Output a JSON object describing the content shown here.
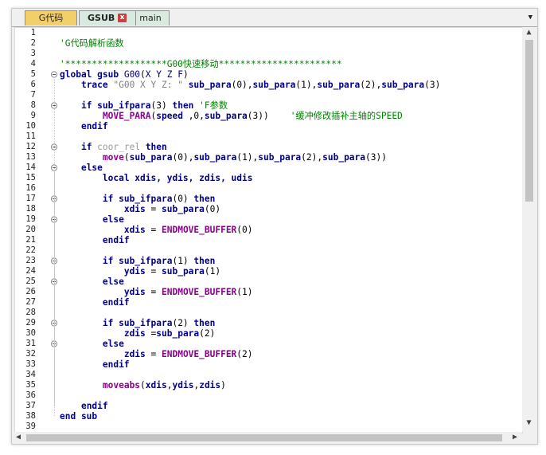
{
  "tabs": [
    {
      "label": "G代码"
    },
    {
      "label": "GSUB",
      "close_label": "x"
    },
    {
      "label": "main"
    }
  ],
  "tab_menu_label": "▼",
  "editor": {
    "lines": [
      {
        "n": "1",
        "code": []
      },
      {
        "n": "2",
        "code": [
          {
            "c": "cm",
            "t": "'G代码解析函数"
          }
        ]
      },
      {
        "n": "3",
        "code": []
      },
      {
        "n": "4",
        "code": [
          {
            "c": "cm",
            "t": "'*******************G00快速移动***********************"
          }
        ]
      },
      {
        "n": "5",
        "fold": "open",
        "code": [
          {
            "c": "kw",
            "t": "global gsub "
          },
          {
            "c": "fn",
            "t": "G00"
          },
          {
            "c": "",
            "t": "("
          },
          {
            "c": "fn",
            "t": "X Y Z F"
          },
          {
            "c": "",
            "t": ")"
          }
        ]
      },
      {
        "n": "6",
        "code": [
          {
            "c": "",
            "t": "    "
          },
          {
            "c": "kw",
            "t": "trace "
          },
          {
            "c": "st",
            "t": "\"G00 X Y Z: \""
          },
          {
            "c": "",
            "t": " "
          },
          {
            "c": "kw",
            "t": "sub_para"
          },
          {
            "c": "",
            "t": "(0),"
          },
          {
            "c": "kw",
            "t": "sub_para"
          },
          {
            "c": "",
            "t": "(1),"
          },
          {
            "c": "kw",
            "t": "sub_para"
          },
          {
            "c": "",
            "t": "(2),"
          },
          {
            "c": "kw",
            "t": "sub_para"
          },
          {
            "c": "",
            "t": "(3)"
          }
        ]
      },
      {
        "n": "7",
        "code": []
      },
      {
        "n": "8",
        "fold": "open",
        "code": [
          {
            "c": "",
            "t": "    "
          },
          {
            "c": "kw",
            "t": "if sub_ifpara"
          },
          {
            "c": "",
            "t": "(3) "
          },
          {
            "c": "kw",
            "t": "then "
          },
          {
            "c": "cm",
            "t": "'F参数"
          }
        ]
      },
      {
        "n": "9",
        "code": [
          {
            "c": "",
            "t": "        "
          },
          {
            "c": "pr",
            "t": "MOVE_PARA"
          },
          {
            "c": "",
            "t": "("
          },
          {
            "c": "kw",
            "t": "speed"
          },
          {
            "c": "",
            "t": " ,0,"
          },
          {
            "c": "kw",
            "t": "sub_para"
          },
          {
            "c": "",
            "t": "(3))    "
          },
          {
            "c": "cm",
            "t": "'缓冲修改插补主轴的SPEED"
          }
        ]
      },
      {
        "n": "10",
        "code": [
          {
            "c": "",
            "t": "    "
          },
          {
            "c": "kw",
            "t": "endif"
          }
        ]
      },
      {
        "n": "11",
        "code": []
      },
      {
        "n": "12",
        "fold": "open",
        "code": [
          {
            "c": "",
            "t": "    "
          },
          {
            "c": "kw",
            "t": "if "
          },
          {
            "c": "gy",
            "t": "coor_rel"
          },
          {
            "c": "",
            "t": " "
          },
          {
            "c": "kw",
            "t": "then"
          }
        ]
      },
      {
        "n": "13",
        "code": [
          {
            "c": "",
            "t": "        "
          },
          {
            "c": "pr",
            "t": "move"
          },
          {
            "c": "",
            "t": "("
          },
          {
            "c": "kw",
            "t": "sub_para"
          },
          {
            "c": "",
            "t": "(0),"
          },
          {
            "c": "kw",
            "t": "sub_para"
          },
          {
            "c": "",
            "t": "(1),"
          },
          {
            "c": "kw",
            "t": "sub_para"
          },
          {
            "c": "",
            "t": "(2),"
          },
          {
            "c": "kw",
            "t": "sub_para"
          },
          {
            "c": "",
            "t": "(3))"
          }
        ]
      },
      {
        "n": "14",
        "fold": "open",
        "code": [
          {
            "c": "",
            "t": "    "
          },
          {
            "c": "kw",
            "t": "else"
          }
        ]
      },
      {
        "n": "15",
        "code": [
          {
            "c": "",
            "t": "        "
          },
          {
            "c": "kw",
            "t": "local xdis, ydis, zdis, udis"
          }
        ]
      },
      {
        "n": "16",
        "code": []
      },
      {
        "n": "17",
        "fold": "open",
        "code": [
          {
            "c": "",
            "t": "        "
          },
          {
            "c": "kw",
            "t": "if sub_ifpara"
          },
          {
            "c": "",
            "t": "(0) "
          },
          {
            "c": "kw",
            "t": "then"
          }
        ]
      },
      {
        "n": "18",
        "code": [
          {
            "c": "",
            "t": "            "
          },
          {
            "c": "kw",
            "t": "xdis"
          },
          {
            "c": "",
            "t": " = "
          },
          {
            "c": "kw",
            "t": "sub_para"
          },
          {
            "c": "",
            "t": "(0)"
          }
        ]
      },
      {
        "n": "19",
        "fold": "open",
        "code": [
          {
            "c": "",
            "t": "        "
          },
          {
            "c": "kw",
            "t": "else"
          }
        ]
      },
      {
        "n": "20",
        "code": [
          {
            "c": "",
            "t": "            "
          },
          {
            "c": "kw",
            "t": "xdis"
          },
          {
            "c": "",
            "t": " = "
          },
          {
            "c": "pr",
            "t": "ENDMOVE_BUFFER"
          },
          {
            "c": "",
            "t": "(0)"
          }
        ]
      },
      {
        "n": "21",
        "code": [
          {
            "c": "",
            "t": "        "
          },
          {
            "c": "kw",
            "t": "endif"
          }
        ]
      },
      {
        "n": "22",
        "code": []
      },
      {
        "n": "23",
        "fold": "open",
        "code": [
          {
            "c": "",
            "t": "        "
          },
          {
            "c": "kw",
            "t": "if sub_ifpara"
          },
          {
            "c": "",
            "t": "(1) "
          },
          {
            "c": "kw",
            "t": "then"
          }
        ]
      },
      {
        "n": "24",
        "code": [
          {
            "c": "",
            "t": "            "
          },
          {
            "c": "kw",
            "t": "ydis"
          },
          {
            "c": "",
            "t": " = "
          },
          {
            "c": "kw",
            "t": "sub_para"
          },
          {
            "c": "",
            "t": "(1)"
          }
        ]
      },
      {
        "n": "25",
        "fold": "open",
        "code": [
          {
            "c": "",
            "t": "        "
          },
          {
            "c": "kw",
            "t": "else"
          }
        ]
      },
      {
        "n": "26",
        "code": [
          {
            "c": "",
            "t": "            "
          },
          {
            "c": "kw",
            "t": "ydis"
          },
          {
            "c": "",
            "t": " = "
          },
          {
            "c": "pr",
            "t": "ENDMOVE_BUFFER"
          },
          {
            "c": "",
            "t": "(1)"
          }
        ]
      },
      {
        "n": "27",
        "code": [
          {
            "c": "",
            "t": "        "
          },
          {
            "c": "kw",
            "t": "endif"
          }
        ]
      },
      {
        "n": "28",
        "code": []
      },
      {
        "n": "29",
        "fold": "open",
        "code": [
          {
            "c": "",
            "t": "        "
          },
          {
            "c": "kw",
            "t": "if sub_ifpara"
          },
          {
            "c": "",
            "t": "(2) "
          },
          {
            "c": "kw",
            "t": "then"
          }
        ]
      },
      {
        "n": "30",
        "code": [
          {
            "c": "",
            "t": "            "
          },
          {
            "c": "kw",
            "t": "zdis"
          },
          {
            "c": "",
            "t": " ="
          },
          {
            "c": "kw",
            "t": "sub_para"
          },
          {
            "c": "",
            "t": "(2)"
          }
        ]
      },
      {
        "n": "31",
        "fold": "open",
        "code": [
          {
            "c": "",
            "t": "        "
          },
          {
            "c": "kw",
            "t": "else"
          }
        ]
      },
      {
        "n": "32",
        "code": [
          {
            "c": "",
            "t": "            "
          },
          {
            "c": "kw",
            "t": "zdis"
          },
          {
            "c": "",
            "t": " = "
          },
          {
            "c": "pr",
            "t": "ENDMOVE_BUFFER"
          },
          {
            "c": "",
            "t": "(2)"
          }
        ]
      },
      {
        "n": "33",
        "code": [
          {
            "c": "",
            "t": "        "
          },
          {
            "c": "kw",
            "t": "endif"
          }
        ]
      },
      {
        "n": "34",
        "code": []
      },
      {
        "n": "35",
        "code": [
          {
            "c": "",
            "t": "        "
          },
          {
            "c": "pr",
            "t": "moveabs"
          },
          {
            "c": "",
            "t": "("
          },
          {
            "c": "kw",
            "t": "xdis"
          },
          {
            "c": "",
            "t": ","
          },
          {
            "c": "kw",
            "t": "ydis"
          },
          {
            "c": "",
            "t": ","
          },
          {
            "c": "kw",
            "t": "zdis"
          },
          {
            "c": "",
            "t": ")"
          }
        ]
      },
      {
        "n": "36",
        "code": []
      },
      {
        "n": "37",
        "code": [
          {
            "c": "",
            "t": "    "
          },
          {
            "c": "kw",
            "t": "endif"
          }
        ]
      },
      {
        "n": "38",
        "code": [
          {
            "c": "kw",
            "t": "end sub"
          }
        ]
      },
      {
        "n": "39",
        "code": []
      }
    ]
  },
  "scroll_up_label": "▲",
  "scroll_down_label": "▼",
  "scroll_left_label": "◀",
  "scroll_right_label": "▶",
  "colors": {
    "active_tab": "#f3cf6a",
    "tab": "#d8eadf",
    "keyword": "#00008b",
    "comment": "#008000",
    "builtin": "#8b008b"
  }
}
